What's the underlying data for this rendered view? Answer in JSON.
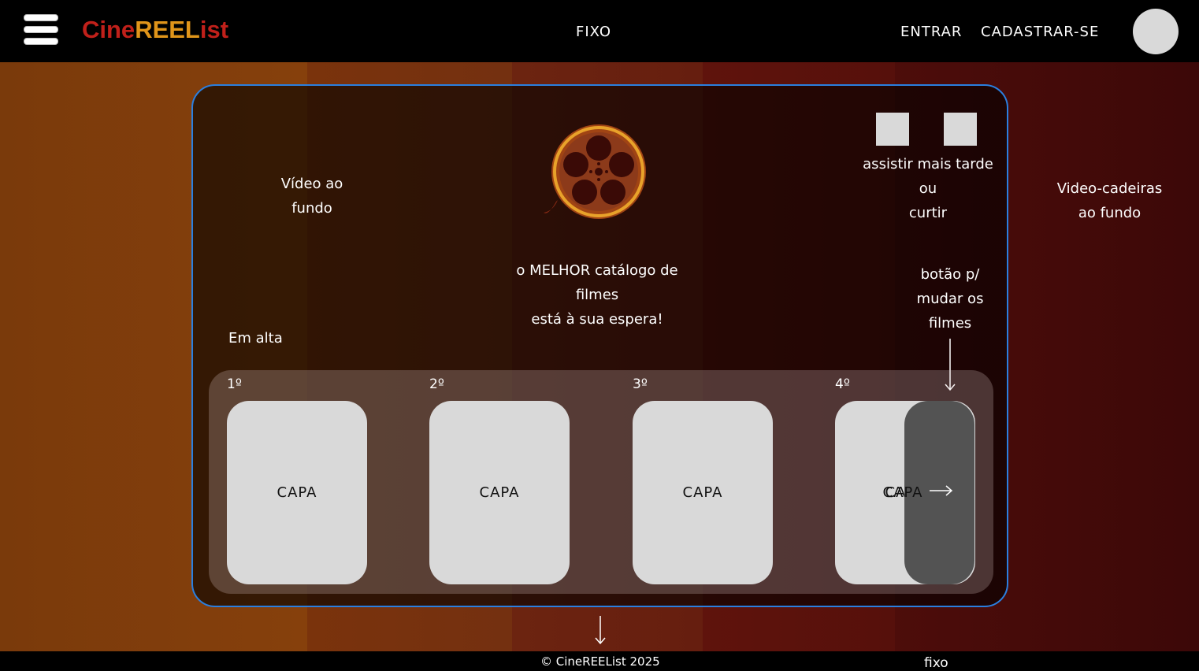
{
  "header": {
    "logo_part1": "Cine",
    "logo_part2": "REEL",
    "logo_part3": "ist",
    "center_label": "FIXO",
    "login_label": "ENTRAR",
    "signup_label": "CADASTRAR-SE"
  },
  "notes": {
    "video_left_line1": "Vídeo ao",
    "video_left_line2": "fundo",
    "video_right_line1": "Video-cadeiras",
    "video_right_line2": "ao fundo",
    "actions_line1": "assistir mais tarde",
    "actions_line2": "ou",
    "actions_line3": "curtir",
    "next_line1": "botão p/",
    "next_line2": "mudar os",
    "next_line3": "filmes",
    "trending_label": "Em alta"
  },
  "hero": {
    "tagline_line1": "o MELHOR catálogo de",
    "tagline_line2": "filmes",
    "tagline_line3": "está à sua espera!"
  },
  "movies": [
    {
      "rank": "1º",
      "cover": "CAPA"
    },
    {
      "rank": "2º",
      "cover": "CAPA"
    },
    {
      "rank": "3º",
      "cover": "CAPA"
    },
    {
      "rank": "4º",
      "cover": "CAPA"
    }
  ],
  "footer": {
    "copyright": "© CineREEList 2025",
    "fixed_label": "fixo"
  },
  "colors": {
    "accent_border": "#2a7fe0",
    "logo_red": "#c0201a",
    "logo_gold": "#e0951a"
  },
  "icons": [
    "hamburger-icon",
    "film-reel-icon",
    "arrow-right-icon",
    "arrow-down-icon"
  ]
}
